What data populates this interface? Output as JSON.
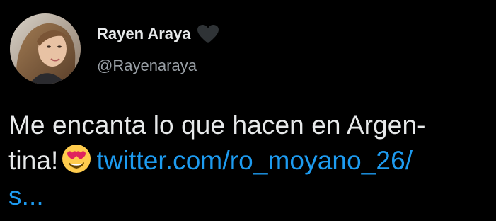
{
  "tweet": {
    "author": {
      "display_name": "Rayen Araya",
      "handle": "@Rayenaraya",
      "badge_icon": "heart-icon",
      "avatar": "avatar"
    },
    "body": {
      "line1": "Me encanta lo que hacen en Argen-",
      "line2_text": "tina!",
      "emoji": "heart-eyes-emoji",
      "link_part1": "twitter.com/ro_moyano_26/",
      "link_part2": "s..."
    }
  },
  "colors": {
    "background": "#000000",
    "text": "#e7e9ea",
    "secondary_text": "#9aa0a6",
    "link": "#1d9bf0",
    "badge": "#2f3336"
  }
}
